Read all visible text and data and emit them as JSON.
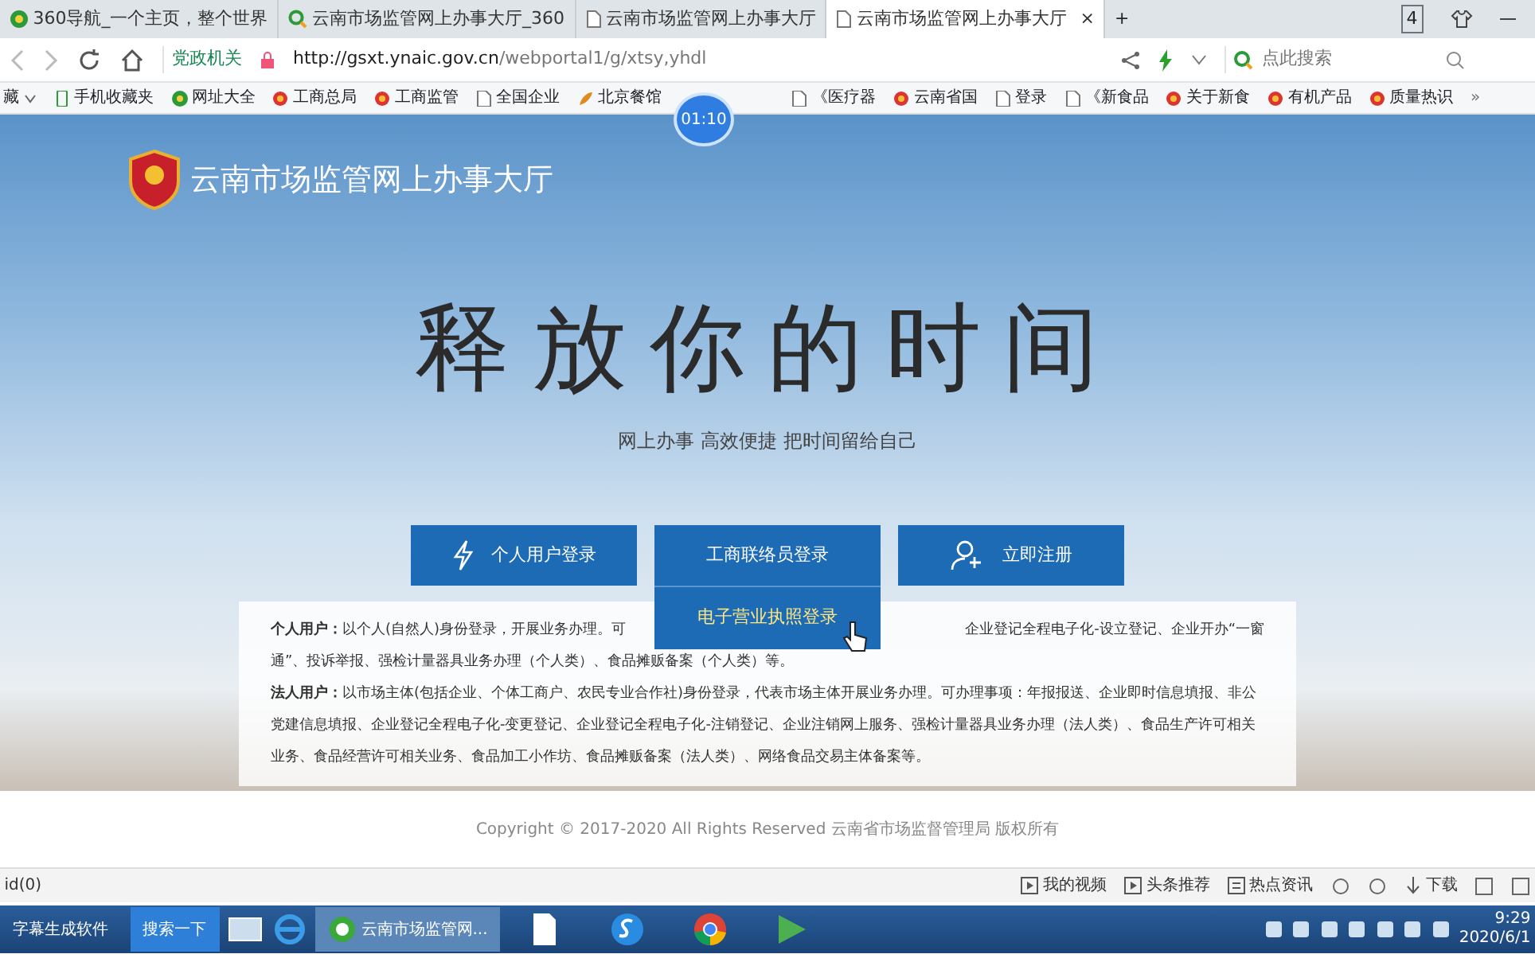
{
  "browser": {
    "tabs": [
      {
        "label": "360导航_一个主页，整个世界",
        "kind": "home",
        "selected": false
      },
      {
        "label": "云南市场监管网上办事大厅_360",
        "kind": "search",
        "selected": false
      },
      {
        "label": "云南市场监管网上办事大厅",
        "kind": "page",
        "selected": false
      },
      {
        "label": "云南市场监管网上办事大厅",
        "kind": "page",
        "selected": true
      }
    ],
    "close": "×",
    "new_tab": "+",
    "tab_count": "4",
    "address": {
      "badge": "党政机关",
      "url_host": "http://gsxt.ynaic.gov.cn",
      "url_path": "/webportal1/g/xtsy,yhdl"
    },
    "search": {
      "placeholder": "点此搜索"
    },
    "bookmarks": [
      {
        "label": "藏",
        "kind": "menu"
      },
      {
        "label": "手机收藏夹",
        "kind": "phone"
      },
      {
        "label": "网址大全",
        "kind": "globe"
      },
      {
        "label": "工商总局",
        "kind": "emblem"
      },
      {
        "label": "工商监管",
        "kind": "emblem"
      },
      {
        "label": "全国企业",
        "kind": "page"
      },
      {
        "label": "北京餐馆",
        "kind": "leaf"
      },
      {
        "label": "《医疗器",
        "kind": "page"
      },
      {
        "label": "云南省国",
        "kind": "emblem"
      },
      {
        "label": "登录",
        "kind": "page"
      },
      {
        "label": "《新食品",
        "kind": "page"
      },
      {
        "label": "关于新食",
        "kind": "emblem"
      },
      {
        "label": "有机产品",
        "kind": "emblem"
      },
      {
        "label": "质量热识",
        "kind": "emblem"
      }
    ],
    "more": "»"
  },
  "timer": "01:10",
  "page": {
    "site_title": "云南市场监管网上办事大厅",
    "headline": "释放你的时间",
    "subtitle": "网上办事 高效便捷 把时间留给自己",
    "buttons": [
      {
        "label": "个人用户登录",
        "kind": "bolt"
      },
      {
        "label": "工商联络员登录",
        "kind": "plain",
        "menu": "电子营业执照登录"
      },
      {
        "label": "立即注册",
        "kind": "user"
      }
    ],
    "info": [
      {
        "label": "个人用户：",
        "before": "以个人(自然人)身份登录，开展业务办理。可",
        "after": "企业登记全程电子化-设立登记、企业开办“一窗",
        "continued": "通”、投诉举报、强检计量器具业务办理（个人类）、食品摊贩备案（个人类）等。"
      },
      {
        "label": "法人用户：",
        "before": "以市场主体(包括企业、个体工商户、农民专业合作社)身份登录，代表市场主体开展业务办理。可办理事项：年报报送、企业即时信息填报、非公党建信息填报、企业登记全程电子化-变更登记、企业登记全程电子化-注销登记、企业注销网上服务、强检计量器具业务办理（法人类）、食品生产许可相关业务、食品经营许可相关业务、食品加工小作坊、食品摊贩备案（法人类）、网络食品交易主体备案等。"
      }
    ],
    "copyright": "Copyright © 2017-2020 All Rights Reserved 云南省市场监督管理局 版权所有"
  },
  "status_bar": {
    "left": "id(0)",
    "items": [
      {
        "label": "我的视频",
        "kind": "play"
      },
      {
        "label": "头条推荐",
        "kind": "play"
      },
      {
        "label": "热点资讯",
        "kind": "news"
      },
      {
        "label": "下载",
        "kind": "download"
      }
    ]
  },
  "taskbar": {
    "apps": [
      {
        "label": "字幕生成软件",
        "kind": "app",
        "selected": false
      },
      {
        "label": "搜索一下",
        "kind": "search",
        "selected": false
      },
      {
        "label": "云南市场监管网...",
        "kind": "browser",
        "selected": true
      }
    ],
    "time": "9:29",
    "date": "2020/6/1"
  }
}
